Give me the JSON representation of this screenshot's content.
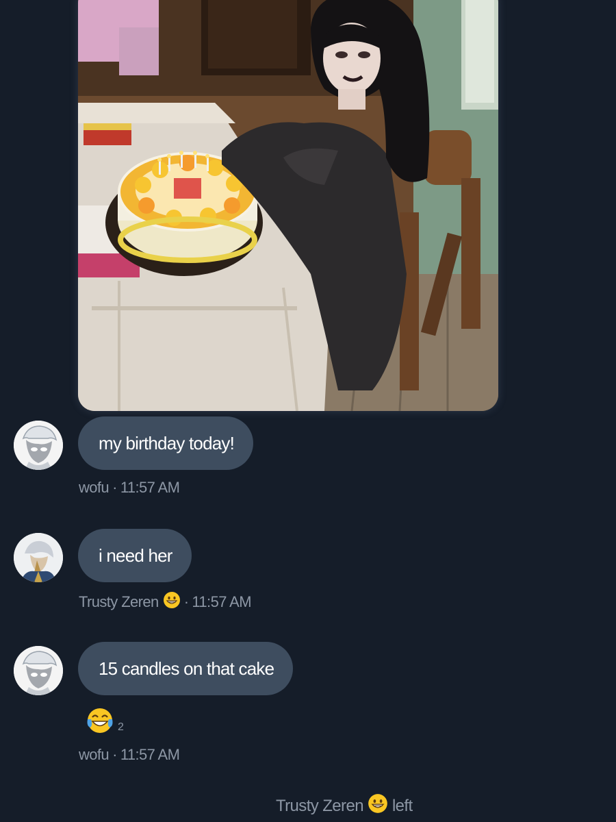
{
  "messages": [
    {
      "text": "my birthday today!",
      "author": "wofu",
      "time": "11:57 AM"
    },
    {
      "text": "i need her",
      "author": "Trusty Zeren",
      "time": "11:57 AM",
      "author_emoji": "grinning-face-icon"
    },
    {
      "text": "15 candles on that cake",
      "author": "wofu",
      "time": "11:57 AM",
      "reaction": {
        "emoji": "tears-of-joy-icon",
        "count": "2"
      }
    }
  ],
  "separator": "·",
  "system_event": {
    "user": "Trusty Zeren",
    "user_emoji": "grinning-face-icon",
    "action": "left"
  },
  "colors": {
    "background": "#151d29",
    "bubble": "#3e4d5f",
    "meta_text": "#8d97a5"
  }
}
